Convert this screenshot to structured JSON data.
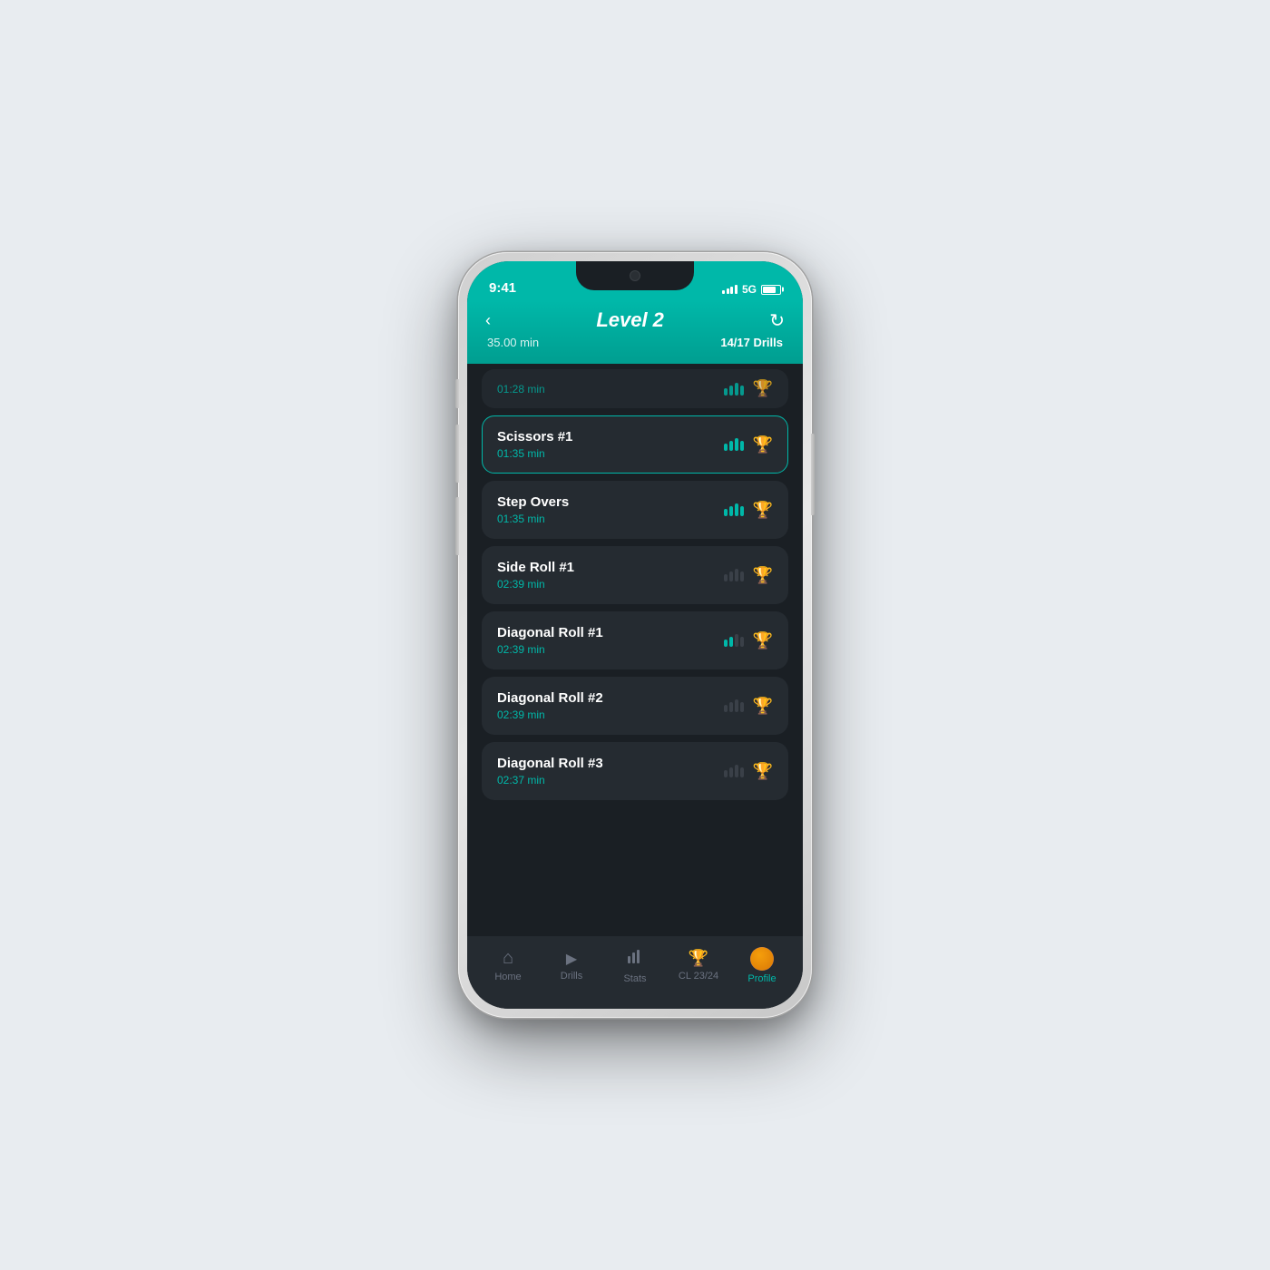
{
  "phone": {
    "status_bar": {
      "time": "9:41",
      "signal": "5G",
      "battery_level": 80
    },
    "header": {
      "back_label": "‹",
      "title": "Level 2",
      "refresh_label": "↻",
      "duration": "35.00 min",
      "drills_count": "14/17 Drills"
    },
    "drills": [
      {
        "id": "top-partial",
        "name": "",
        "time": "01:28 min",
        "bars": [
          4,
          4,
          4,
          4
        ],
        "bars_filled": 4,
        "trophy": "earned",
        "active": false,
        "partial_top": true
      },
      {
        "id": "scissors-1",
        "name": "Scissors #1",
        "time": "01:35 min",
        "bars_filled": 4,
        "bars_total": 4,
        "trophy": "earned",
        "active": true
      },
      {
        "id": "step-overs",
        "name": "Step Overs",
        "time": "01:35 min",
        "bars_filled": 4,
        "bars_total": 4,
        "trophy": "empty",
        "active": false
      },
      {
        "id": "side-roll-1",
        "name": "Side Roll #1",
        "time": "02:39 min",
        "bars_filled": 0,
        "bars_total": 4,
        "trophy": "empty",
        "active": false
      },
      {
        "id": "diagonal-roll-1",
        "name": "Diagonal Roll #1",
        "time": "02:39 min",
        "bars_filled": 2,
        "bars_total": 4,
        "trophy": "empty",
        "active": false
      },
      {
        "id": "diagonal-roll-2",
        "name": "Diagonal Roll #2",
        "time": "02:39 min",
        "bars_filled": 0,
        "bars_total": 4,
        "trophy": "empty",
        "active": false
      },
      {
        "id": "diagonal-roll-3",
        "name": "Diagonal Roll #3",
        "time": "02:37 min",
        "bars_filled": 0,
        "bars_total": 4,
        "trophy": "empty",
        "active": false
      }
    ],
    "nav": {
      "items": [
        {
          "id": "home",
          "label": "Home",
          "icon": "⌂",
          "active": false
        },
        {
          "id": "drills",
          "label": "Drills",
          "icon": "▶",
          "active": false
        },
        {
          "id": "stats",
          "label": "Stats",
          "icon": "▦",
          "active": false
        },
        {
          "id": "cl",
          "label": "CL 23/24",
          "icon": "🏆",
          "active": false
        },
        {
          "id": "profile",
          "label": "Profile",
          "icon": "avatar",
          "active": true
        }
      ]
    }
  }
}
